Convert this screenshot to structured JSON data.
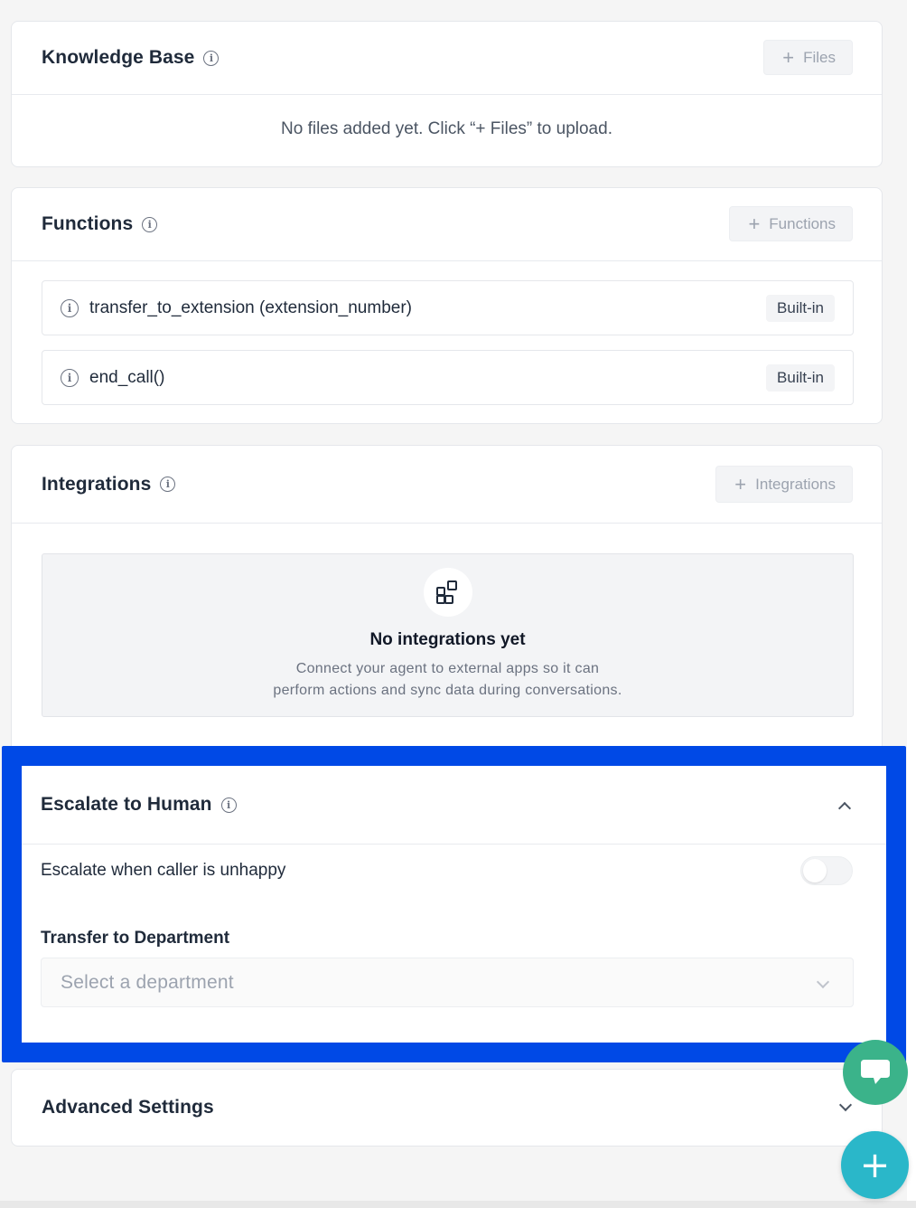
{
  "knowledge_base": {
    "title": "Knowledge Base",
    "info_icon": "info-icon",
    "add_button_label": "Files",
    "empty_message": "No files added yet. Click “+ Files” to upload."
  },
  "functions": {
    "title": "Functions",
    "info_icon": "info-icon",
    "add_button_label": "Functions",
    "items": [
      {
        "name": "transfer_to_extension (extension_number)",
        "badge": "Built-in"
      },
      {
        "name": "end_call()",
        "badge": "Built-in"
      }
    ]
  },
  "integrations": {
    "title": "Integrations",
    "info_icon": "info-icon",
    "add_button_label": "Integrations",
    "empty_icon": "apps-grid-icon",
    "empty_title": "No integrations yet",
    "empty_desc_line1": "Connect your agent to external apps so it can",
    "empty_desc_line2": "perform actions and sync data during conversations."
  },
  "escalate": {
    "title": "Escalate to Human",
    "info_icon": "info-icon",
    "expanded": true,
    "toggle_label": "Escalate when caller is unhappy",
    "toggle_on": false,
    "department_label": "Transfer to Department",
    "department_placeholder": "Select a department",
    "highlight_color": "#0049e6"
  },
  "advanced": {
    "title": "Advanced Settings",
    "expanded": false
  },
  "fabs": {
    "chat_icon": "chat-bubble-icon",
    "chat_color": "#3bb38a",
    "add_symbol": "+",
    "add_color": "#2ab7c9"
  }
}
